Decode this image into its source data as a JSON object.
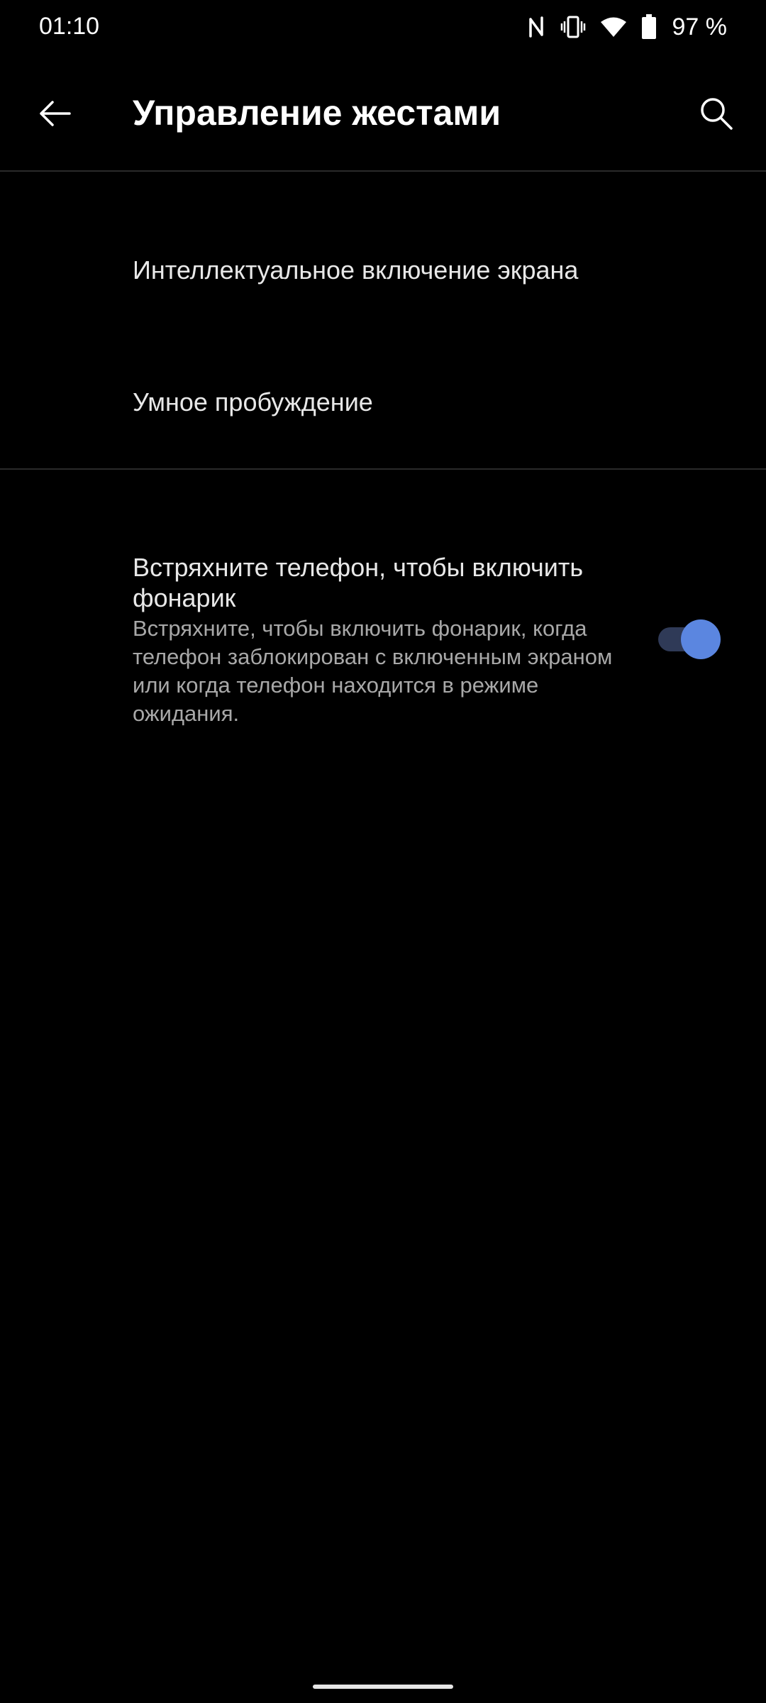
{
  "status_bar": {
    "time": "01:10",
    "battery_percent": "97 %",
    "icons": [
      "nfc-icon",
      "vibrate-icon",
      "wifi-icon",
      "battery-icon"
    ]
  },
  "toolbar": {
    "title": "Управление жестами",
    "back_icon": "arrow-left-icon",
    "search_icon": "search-icon"
  },
  "items": [
    {
      "title": "Интеллектуальное включение экрана"
    },
    {
      "title": "Умное пробуждение"
    }
  ],
  "shake_flashlight": {
    "title": "Встряхните телефон, чтобы включить фонарик",
    "summary": "Встряхните, чтобы включить фонарик, когда телефон заблокирован с включенным экраном или когда телефон находится в режиме ожидания.",
    "enabled": true
  },
  "colors": {
    "background": "#000000",
    "accent": "#5b86e0",
    "switch_track": "#2f3a57"
  }
}
